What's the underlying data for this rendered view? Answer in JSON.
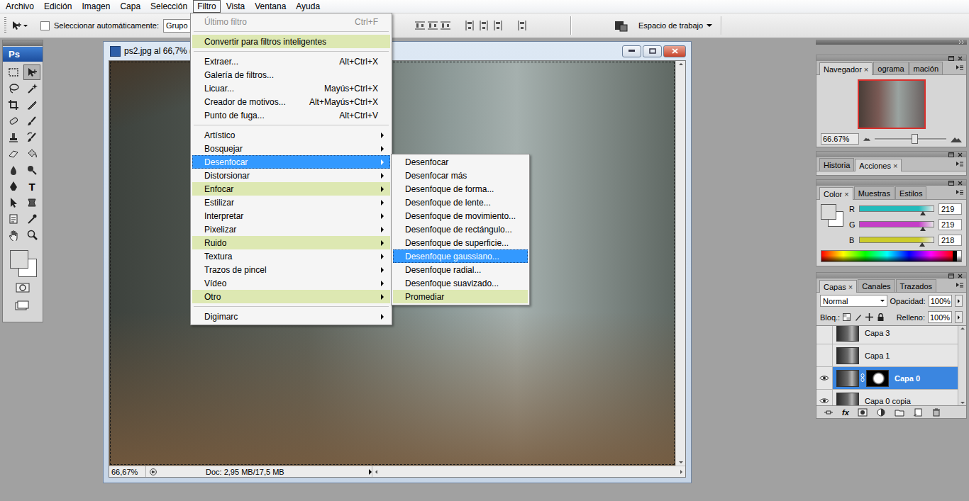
{
  "menubar": [
    {
      "label": "Archivo",
      "selected": false
    },
    {
      "label": "Edición",
      "selected": false
    },
    {
      "label": "Imagen",
      "selected": false
    },
    {
      "label": "Capa",
      "selected": false
    },
    {
      "label": "Selección",
      "selected": false
    },
    {
      "label": "Filtro",
      "selected": true
    },
    {
      "label": "Vista",
      "selected": false
    },
    {
      "label": "Ventana",
      "selected": false
    },
    {
      "label": "Ayuda",
      "selected": false
    }
  ],
  "options_bar": {
    "auto_select": {
      "label": "Seleccionar automáticamente:",
      "checked": false
    },
    "target": "Grupo",
    "workspace": "Espacio de trabajo"
  },
  "toolbox": {
    "logo": "Ps",
    "tools": [
      {
        "kind": "marquee",
        "selected": false
      },
      {
        "kind": "move",
        "selected": true
      },
      {
        "kind": "lasso",
        "selected": false
      },
      {
        "kind": "wand",
        "selected": false
      },
      {
        "kind": "crop",
        "selected": false
      },
      {
        "kind": "slice",
        "selected": false
      },
      {
        "kind": "heal",
        "selected": false
      },
      {
        "kind": "brush",
        "selected": false
      },
      {
        "kind": "stamp",
        "selected": false
      },
      {
        "kind": "history",
        "selected": false
      },
      {
        "kind": "eraser",
        "selected": false
      },
      {
        "kind": "bucket",
        "selected": false
      },
      {
        "kind": "blur",
        "selected": false
      },
      {
        "kind": "dodge",
        "selected": false
      },
      {
        "kind": "pen",
        "selected": false
      },
      {
        "kind": "text",
        "selected": false,
        "glyph": "T"
      },
      {
        "kind": "path",
        "selected": false
      },
      {
        "kind": "shape",
        "selected": false
      },
      {
        "kind": "notes",
        "selected": false
      },
      {
        "kind": "eyedropper",
        "selected": false
      },
      {
        "kind": "hand",
        "selected": false
      },
      {
        "kind": "zoom",
        "selected": false
      }
    ]
  },
  "document": {
    "title": "ps2.jpg al 66,7% (",
    "zoom": "66,67%",
    "info": "Doc: 2,95 MB/17,5 MB"
  },
  "filter_menu": [
    {
      "kind": "item",
      "label": "Último filtro",
      "shortcut": "Ctrl+F",
      "submenu": false,
      "disabled": true,
      "highlighted": false,
      "selected": false
    },
    {
      "kind": "separator"
    },
    {
      "kind": "item",
      "label": "Convertir para filtros inteligentes",
      "shortcut": "",
      "submenu": false,
      "disabled": false,
      "highlighted": true,
      "selected": false
    },
    {
      "kind": "separator"
    },
    {
      "kind": "item",
      "label": "Extraer...",
      "shortcut": "Alt+Ctrl+X",
      "submenu": false,
      "disabled": false,
      "highlighted": false,
      "selected": false
    },
    {
      "kind": "item",
      "label": "Galería de filtros...",
      "shortcut": "",
      "submenu": false,
      "disabled": false,
      "highlighted": false,
      "selected": false
    },
    {
      "kind": "item",
      "label": "Licuar...",
      "shortcut": "Mayús+Ctrl+X",
      "submenu": false,
      "disabled": false,
      "highlighted": false,
      "selected": false
    },
    {
      "kind": "item",
      "label": "Creador de motivos...",
      "shortcut": "Alt+Mayús+Ctrl+X",
      "submenu": false,
      "disabled": false,
      "highlighted": false,
      "selected": false
    },
    {
      "kind": "item",
      "label": "Punto de fuga...",
      "shortcut": "Alt+Ctrl+V",
      "submenu": false,
      "disabled": false,
      "highlighted": false,
      "selected": false
    },
    {
      "kind": "separator"
    },
    {
      "kind": "item",
      "label": "Artístico",
      "shortcut": "",
      "submenu": true,
      "disabled": false,
      "highlighted": false,
      "selected": false
    },
    {
      "kind": "item",
      "label": "Bosquejar",
      "shortcut": "",
      "submenu": true,
      "disabled": false,
      "highlighted": false,
      "selected": false
    },
    {
      "kind": "item",
      "label": "Desenfocar",
      "shortcut": "",
      "submenu": true,
      "disabled": false,
      "highlighted": false,
      "selected": true
    },
    {
      "kind": "item",
      "label": "Distorsionar",
      "shortcut": "",
      "submenu": true,
      "disabled": false,
      "highlighted": false,
      "selected": false
    },
    {
      "kind": "item",
      "label": "Enfocar",
      "shortcut": "",
      "submenu": true,
      "disabled": false,
      "highlighted": true,
      "selected": false
    },
    {
      "kind": "item",
      "label": "Estilizar",
      "shortcut": "",
      "submenu": true,
      "disabled": false,
      "highlighted": false,
      "selected": false
    },
    {
      "kind": "item",
      "label": "Interpretar",
      "shortcut": "",
      "submenu": true,
      "disabled": false,
      "highlighted": false,
      "selected": false
    },
    {
      "kind": "item",
      "label": "Pixelizar",
      "shortcut": "",
      "submenu": true,
      "disabled": false,
      "highlighted": false,
      "selected": false
    },
    {
      "kind": "item",
      "label": "Ruido",
      "shortcut": "",
      "submenu": true,
      "disabled": false,
      "highlighted": true,
      "selected": false
    },
    {
      "kind": "item",
      "label": "Textura",
      "shortcut": "",
      "submenu": true,
      "disabled": false,
      "highlighted": false,
      "selected": false
    },
    {
      "kind": "item",
      "label": "Trazos de pincel",
      "shortcut": "",
      "submenu": true,
      "disabled": false,
      "highlighted": false,
      "selected": false
    },
    {
      "kind": "item",
      "label": "Vídeo",
      "shortcut": "",
      "submenu": true,
      "disabled": false,
      "highlighted": false,
      "selected": false
    },
    {
      "kind": "item",
      "label": "Otro",
      "shortcut": "",
      "submenu": true,
      "disabled": false,
      "highlighted": true,
      "selected": false
    },
    {
      "kind": "separator"
    },
    {
      "kind": "item",
      "label": "Digimarc",
      "shortcut": "",
      "submenu": true,
      "disabled": false,
      "highlighted": false,
      "selected": false
    }
  ],
  "blur_submenu": [
    {
      "label": "Desenfocar",
      "highlighted": false,
      "selected": false
    },
    {
      "label": "Desenfocar más",
      "highlighted": false,
      "selected": false
    },
    {
      "label": "Desenfoque de forma...",
      "highlighted": false,
      "selected": false
    },
    {
      "label": "Desenfoque de lente...",
      "highlighted": false,
      "selected": false
    },
    {
      "label": "Desenfoque de movimiento...",
      "highlighted": false,
      "selected": false
    },
    {
      "label": "Desenfoque de rectángulo...",
      "highlighted": false,
      "selected": false
    },
    {
      "label": "Desenfoque de superficie...",
      "highlighted": false,
      "selected": false
    },
    {
      "label": "Desenfoque gaussiano...",
      "highlighted": false,
      "selected": true
    },
    {
      "label": "Desenfoque radial...",
      "highlighted": false,
      "selected": false
    },
    {
      "label": "Desenfoque suavizado...",
      "highlighted": false,
      "selected": false
    },
    {
      "label": "Promediar",
      "highlighted": true,
      "selected": false
    }
  ],
  "panels": {
    "navigator": {
      "tabs": [
        {
          "label": "Navegador",
          "close": "×",
          "selected": true
        },
        {
          "label": "ograma",
          "selected": false
        },
        {
          "label": "mación",
          "selected": false
        }
      ],
      "zoom": "66.67%",
      "level": 0.55
    },
    "history": {
      "tabs": [
        {
          "label": "Historia",
          "selected": false
        },
        {
          "label": "Acciones",
          "close": "×",
          "selected": true
        }
      ]
    },
    "color": {
      "tabs": [
        {
          "label": "Color",
          "close": "×",
          "selected": true
        },
        {
          "label": "Muestras",
          "selected": false
        },
        {
          "label": "Estilos",
          "selected": false
        }
      ],
      "channels": [
        {
          "name": "R",
          "value": "219",
          "level": 0.86,
          "color": "#22bcbc"
        },
        {
          "name": "G",
          "value": "219",
          "level": 0.86,
          "color": "#c53ec8"
        },
        {
          "name": "B",
          "value": "218",
          "level": 0.85,
          "color": "#cccc2a"
        }
      ]
    },
    "layers": {
      "tabs": [
        {
          "label": "Capas",
          "close": "×",
          "selected": true
        },
        {
          "label": "Canales",
          "selected": false
        },
        {
          "label": "Trazados",
          "selected": false
        }
      ],
      "blend_mode": "Normal",
      "opacity_label": "Opacidad:",
      "opacity": "100%",
      "lock_label": "Bloq.:",
      "fill_label": "Relleno:",
      "fill": "100%",
      "footer_fx": "fx",
      "layers": [
        {
          "name": "Capa 3",
          "visible": false,
          "selected": false,
          "mask": false
        },
        {
          "name": "Capa 1",
          "visible": false,
          "selected": false,
          "mask": false
        },
        {
          "name": "Capa 0",
          "visible": true,
          "selected": true,
          "mask": true
        },
        {
          "name": "Capa 0 copia",
          "visible": true,
          "selected": false,
          "mask": false
        }
      ]
    }
  }
}
